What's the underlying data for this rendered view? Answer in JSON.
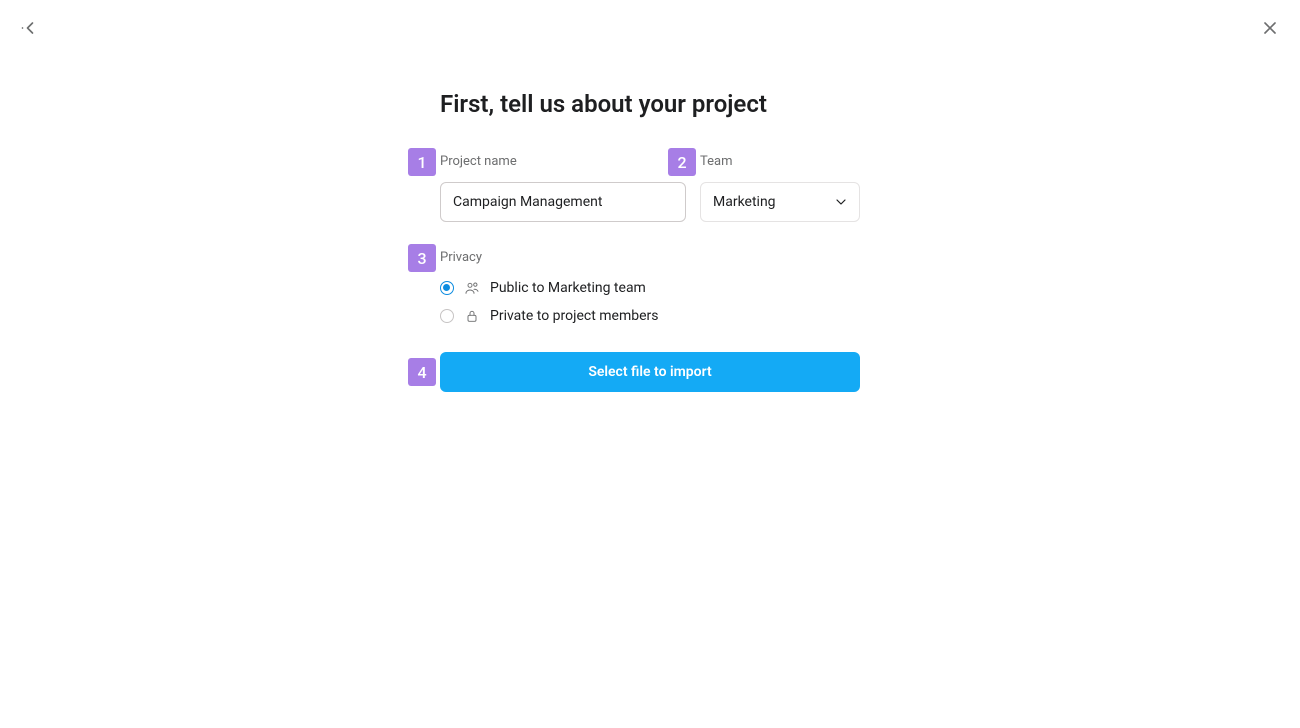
{
  "title": "First, tell us about your project",
  "steps": {
    "name": {
      "num": "1",
      "label": "Project name",
      "value": "Campaign Management"
    },
    "team": {
      "num": "2",
      "label": "Team",
      "value": "Marketing"
    },
    "privacy": {
      "num": "3",
      "label": "Privacy",
      "options": [
        {
          "label": "Public to Marketing team",
          "selected": true
        },
        {
          "label": "Private to project members",
          "selected": false
        }
      ]
    },
    "action": {
      "num": "4",
      "label": "Select file to import"
    }
  },
  "colors": {
    "badge": "#a77ee6",
    "primary": "#14aaf5",
    "radio_selected": "#0d8ce0"
  }
}
